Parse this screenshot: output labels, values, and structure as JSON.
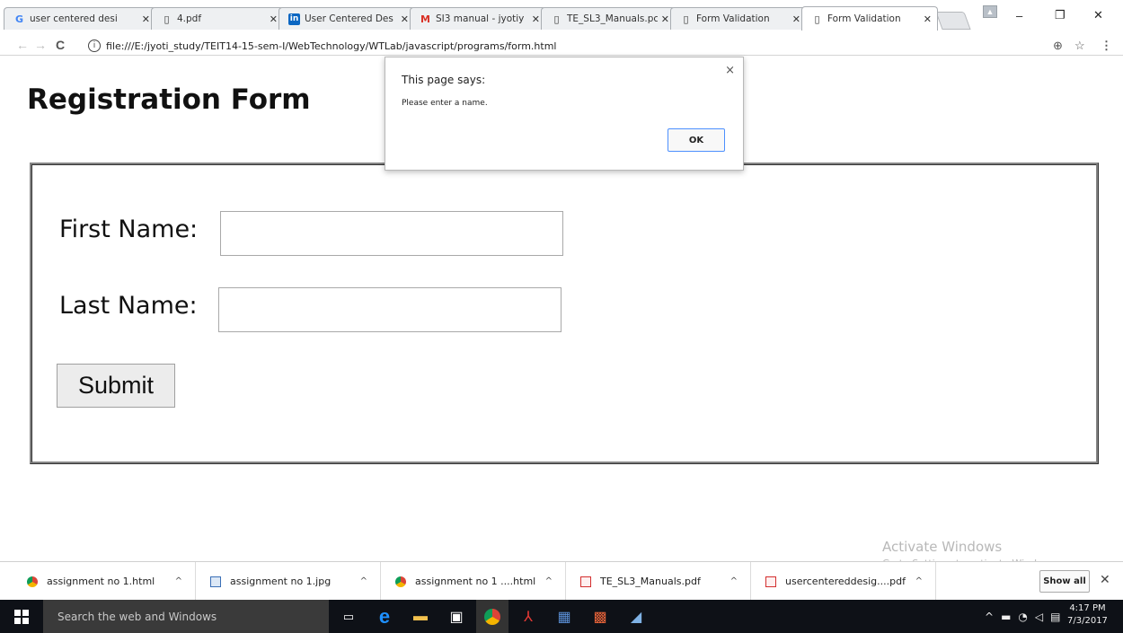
{
  "browser": {
    "tabs": [
      {
        "title": "user centered desi",
        "icon": "google-icon"
      },
      {
        "title": "4.pdf",
        "icon": "page-icon"
      },
      {
        "title": "User Centered Des",
        "icon": "linkedin-icon"
      },
      {
        "title": "SI3 manual - jyotiy",
        "icon": "gmail-icon"
      },
      {
        "title": "TE_SL3_Manuals.pc",
        "icon": "page-icon"
      },
      {
        "title": "Form Validation",
        "icon": "page-icon"
      },
      {
        "title": "Form Validation",
        "icon": "page-icon"
      }
    ],
    "url": "file:///E:/jyoti_study/TEIT14-15-sem-I/WebTechnology/WTLab/javascript/programs/form.html"
  },
  "page": {
    "heading": "Registration Form",
    "first_name_label": "First Name:",
    "last_name_label": "Last Name:",
    "first_name_value": "",
    "last_name_value": "",
    "submit_label": "Submit"
  },
  "dialog": {
    "title": "This page says:",
    "message": "Please enter a name.",
    "ok_label": "OK",
    "close": "×"
  },
  "watermark": {
    "line1": "Activate Windows",
    "line2": "Go to Settings to activate Windows."
  },
  "downloads": {
    "items": [
      {
        "name": "assignment no 1.html",
        "icon": "chrome-icon"
      },
      {
        "name": "assignment no 1.jpg",
        "icon": "image-file-icon"
      },
      {
        "name": "assignment no 1 ....html",
        "icon": "chrome-icon"
      },
      {
        "name": "TE_SL3_Manuals.pdf",
        "icon": "pdf-icon"
      },
      {
        "name": "usercentereddesig....pdf",
        "icon": "pdf-icon"
      }
    ],
    "show_all_label": "Show all"
  },
  "taskbar": {
    "search_placeholder": "Search the web and Windows",
    "time": "4:17 PM",
    "date": "7/3/2017"
  },
  "colors": {
    "taskbar": "#0e1117",
    "accent_blue": "#4d90fe",
    "form_border": "#858585"
  }
}
